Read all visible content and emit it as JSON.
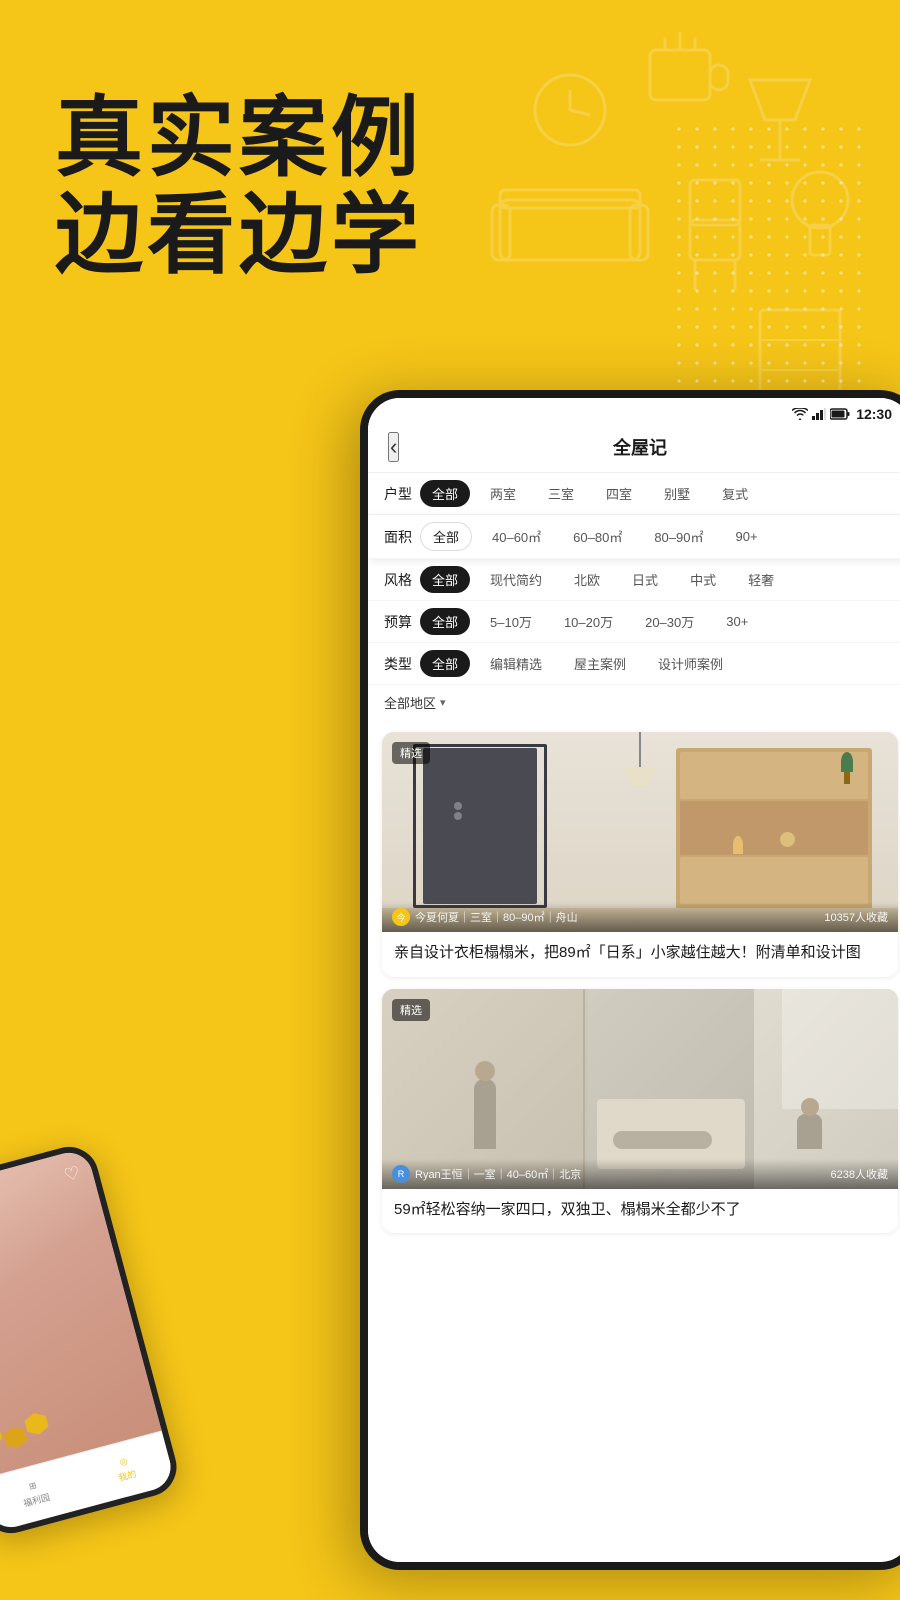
{
  "hero": {
    "line1": "真实案例",
    "line2": "边看边学"
  },
  "status_bar": {
    "time": "12:30",
    "wifi_icon": "wifi",
    "signal_icon": "signal",
    "battery_icon": "battery"
  },
  "nav": {
    "back_icon": "‹",
    "title": "全屋记"
  },
  "filters": {
    "huType": {
      "label": "户型",
      "chips": [
        "全部",
        "两室",
        "三室",
        "四室",
        "别墅",
        "复式"
      ]
    },
    "area": {
      "label": "面积",
      "chips": [
        "全部",
        "40–60㎡",
        "60–80㎡",
        "80–90㎡",
        "90+"
      ]
    },
    "style": {
      "label": "风格",
      "chips": [
        "全部",
        "现代简约",
        "北欧",
        "日式",
        "中式",
        "轻奢"
      ]
    },
    "budget": {
      "label": "预算",
      "chips": [
        "全部",
        "5–10万",
        "10–20万",
        "20–30万",
        "30+"
      ]
    },
    "type": {
      "label": "类型",
      "chips": [
        "全部",
        "编辑精选",
        "屋主案例",
        "设计师案例"
      ]
    },
    "region": {
      "label": "全部地区",
      "arrow": "▾"
    }
  },
  "cards": [
    {
      "badge": "精选",
      "author": "今夏何夏",
      "author_initial": "今",
      "meta": "三室｜80–90㎡｜舟山",
      "saves": "10357人收藏",
      "title": "亲自设计衣柜榻榻米，把89㎡「日系」小家越住越大！附清单和设计图"
    },
    {
      "badge": "精选",
      "author": "Ryan王恒",
      "author_initial": "R",
      "meta": "一室｜40–60㎡｜北京",
      "saves": "6238人收藏",
      "title": "59㎡轻松容纳一家四口，双独卫、榻榻米全都少不了"
    }
  ],
  "phone_left": {
    "nav_items": [
      "福利园",
      "我的"
    ]
  }
}
